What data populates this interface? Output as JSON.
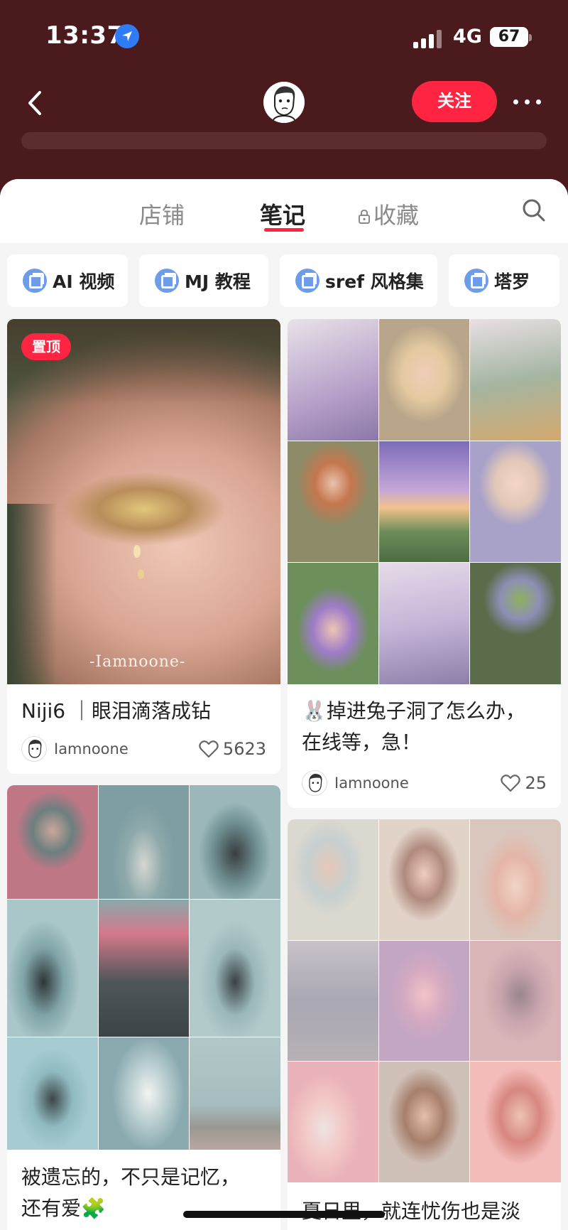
{
  "status": {
    "time": "13:37",
    "network": "4G",
    "battery": "67"
  },
  "nav": {
    "follow_label": "关注"
  },
  "tabs": {
    "shop": "店铺",
    "notes": "笔记",
    "collections": "收藏"
  },
  "chips": [
    "AI 视频",
    "MJ 教程",
    "sref 风格集",
    "塔罗"
  ],
  "notes": [
    {
      "pin_label": "置顶",
      "watermark": "-Iamnoone-",
      "title": "Niji6 ｜眼泪滴落成钻",
      "author": "Iamnoone",
      "likes": "5623"
    },
    {
      "title_line1": "🐰掉进兔子洞了怎么办，",
      "title_line2": "在线等，急！",
      "author": "Iamnoone",
      "likes": "25"
    },
    {
      "title_line1": "被遗忘的，不只是记忆，",
      "title_line2": "还有爱🧩"
    },
    {
      "title_line1": "夏日里，就连忧伤也是淡"
    }
  ],
  "colors": {
    "accent": "#ff2442",
    "header_bg": "#4a1a1c"
  }
}
